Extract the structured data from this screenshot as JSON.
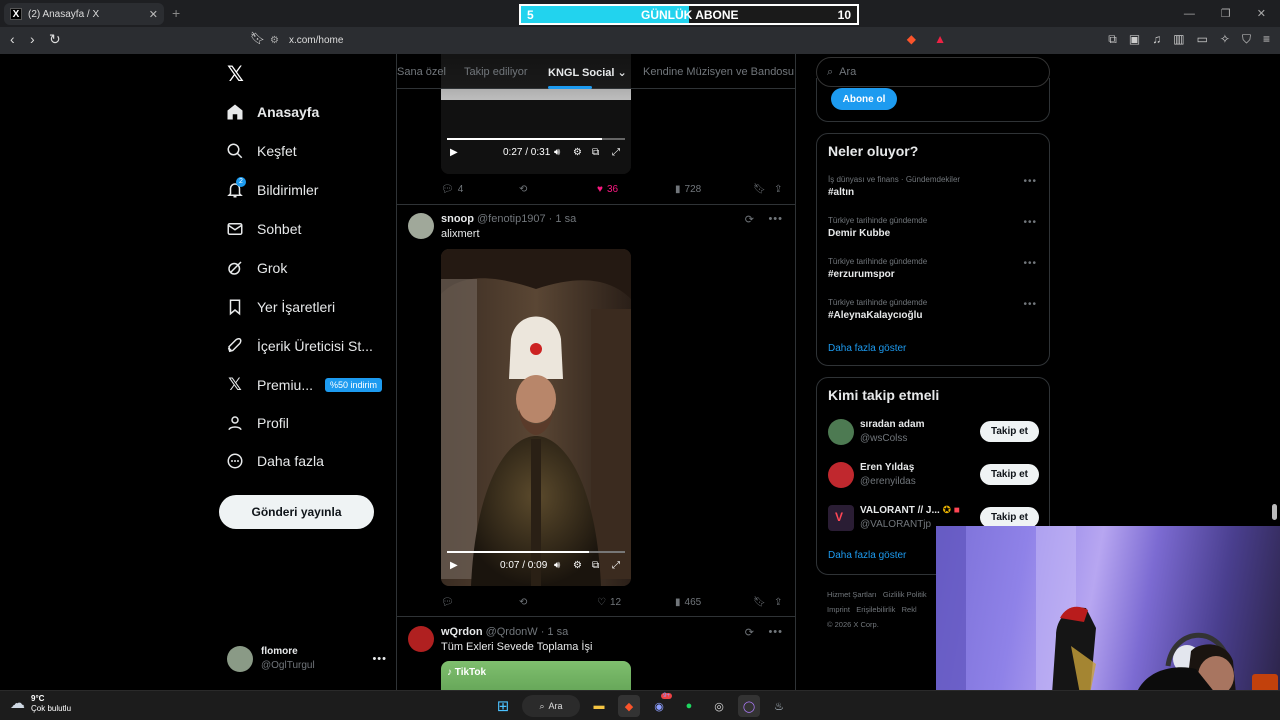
{
  "browser": {
    "tab_title": "(2) Anasayfa / X",
    "new_tab": "+",
    "url": "x.com/home",
    "abone_overlay": {
      "left": "5",
      "label": "GÜNLÜK ABONE",
      "right": "10",
      "progress": 0.5
    }
  },
  "sidebar": {
    "items": [
      {
        "label": "Anasayfa",
        "icon": "home-icon"
      },
      {
        "label": "Keşfet",
        "icon": "search-icon"
      },
      {
        "label": "Bildirimler",
        "icon": "bell-icon",
        "badge": "2"
      },
      {
        "label": "Sohbet",
        "icon": "mail-icon"
      },
      {
        "label": "Grok",
        "icon": "grok-icon"
      },
      {
        "label": "Yer İşaretleri",
        "icon": "bookmark-icon"
      },
      {
        "label": "İçerik Üreticisi St...",
        "icon": "rocket-icon"
      },
      {
        "label": "Premiu...",
        "icon": "x-logo-icon",
        "promo": "%50 indirim"
      },
      {
        "label": "Profil",
        "icon": "person-icon"
      },
      {
        "label": "Daha fazla",
        "icon": "more-circle-icon"
      }
    ],
    "post_button": "Gönderi yayınla",
    "account": {
      "name": "flomore",
      "handle": "@OglTurgul"
    }
  },
  "feed": {
    "tabs": [
      "Sana özel",
      "Takip ediliyor",
      "KNGL Social",
      "Kendine Müzisyen ve Bandosu"
    ],
    "active_tab": "KNGL Social",
    "tweet0": {
      "video_time": "0:27 / 0:31",
      "progress": 0.87,
      "replies": "4",
      "likes": "36",
      "views": "728"
    },
    "tweet1": {
      "name": "snoop",
      "handle": "@fenotip1907",
      "time": "· 1 sa",
      "text": "alixmert",
      "video_time": "0:07 / 0:09",
      "progress": 0.8,
      "likes": "12",
      "views": "465"
    },
    "tweet2": {
      "name": "wQrdon",
      "handle": "@QrdonW",
      "time": "· 1 sa",
      "text": "Tüm Exleri Sevede Toplama İşi",
      "video_label": "TikTok"
    }
  },
  "right": {
    "search_placeholder": "Ara",
    "subscribe_button": "Abone ol",
    "trends_title": "Neler oluyor?",
    "trends": [
      {
        "category": "İş dünyası ve finans · Gündemdekiler",
        "name": "#altın"
      },
      {
        "category": "Türkiye tarihinde gündemde",
        "name": "Demir Kubbe"
      },
      {
        "category": "Türkiye tarihinde gündemde",
        "name": "#erzurumspor"
      },
      {
        "category": "Türkiye tarihinde gündemde",
        "name": "#AleynaKalaycıoğlu"
      }
    ],
    "show_more": "Daha fazla göster",
    "follow_title": "Kimi takip etmeli",
    "follow": [
      {
        "name": "sıradan adam",
        "handle": "@wsColss",
        "button": "Takip et"
      },
      {
        "name": "Eren Yıldaş",
        "handle": "@erenyildas",
        "button": "Takip et"
      },
      {
        "name": "VALORANT // J...",
        "handle": "@VALORANTjp",
        "button": "Takip et"
      }
    ],
    "follow_more": "Daha fazla göster",
    "footer": [
      "Hizmet Şartları",
      "Gizlilik Politik",
      "Imprint",
      "Erişilebilirlik",
      "Rekl",
      "© 2026 X Corp."
    ]
  },
  "taskbar": {
    "temp": "9°C",
    "weather": "Çok bulutlu",
    "search": "Ara",
    "discord_badge": "9+"
  },
  "colors": {
    "accent": "#1d9bf0",
    "like": "#f91880",
    "bg": "#000000",
    "border": "#2f3336"
  }
}
